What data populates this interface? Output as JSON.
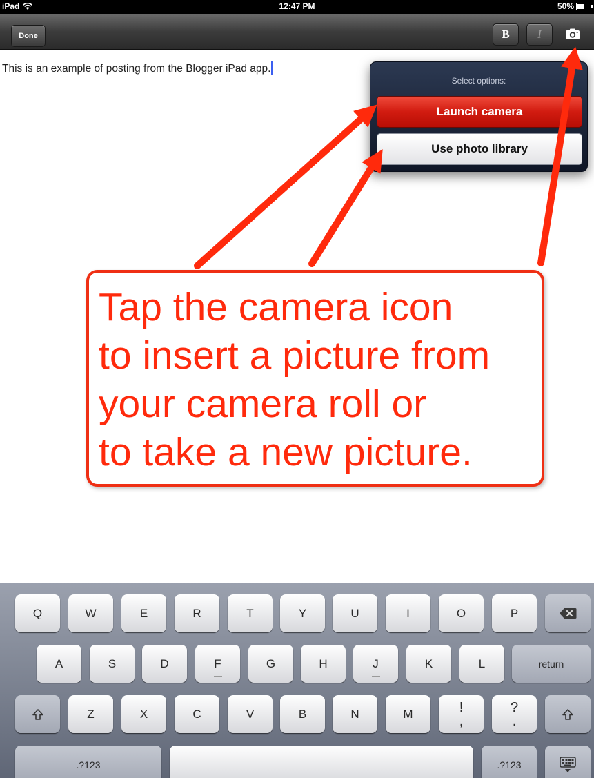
{
  "status_bar": {
    "device": "iPad",
    "time": "12:47 PM",
    "battery": "50%",
    "battery_level": 0.5
  },
  "toolbar": {
    "done_label": "Done",
    "bold_label": "B",
    "italic_label": "I"
  },
  "editor": {
    "text": "This is an example of posting from the Blogger iPad app."
  },
  "popover": {
    "title": "Select options:",
    "launch_camera_label": "Launch camera",
    "photo_library_label": "Use photo library"
  },
  "callout": {
    "lines": [
      "Tap the camera icon",
      "to insert a picture from",
      "your camera roll or",
      "to take a new picture."
    ]
  },
  "keyboard": {
    "row1": [
      "Q",
      "W",
      "E",
      "R",
      "T",
      "Y",
      "U",
      "I",
      "O",
      "P"
    ],
    "row2": [
      "A",
      "S",
      "D",
      "F",
      "G",
      "H",
      "J",
      "K",
      "L"
    ],
    "row2_return": "return",
    "row3": [
      "Z",
      "X",
      "C",
      "V",
      "B",
      "N",
      "M"
    ],
    "row3_punct1": [
      "!",
      ","
    ],
    "row3_punct2": [
      "?",
      "."
    ],
    "numbers_label": ".?123"
  },
  "colors": {
    "annotation": "#ff2a0c",
    "launch_button": "#d11b10",
    "popover": "#1a2338"
  }
}
